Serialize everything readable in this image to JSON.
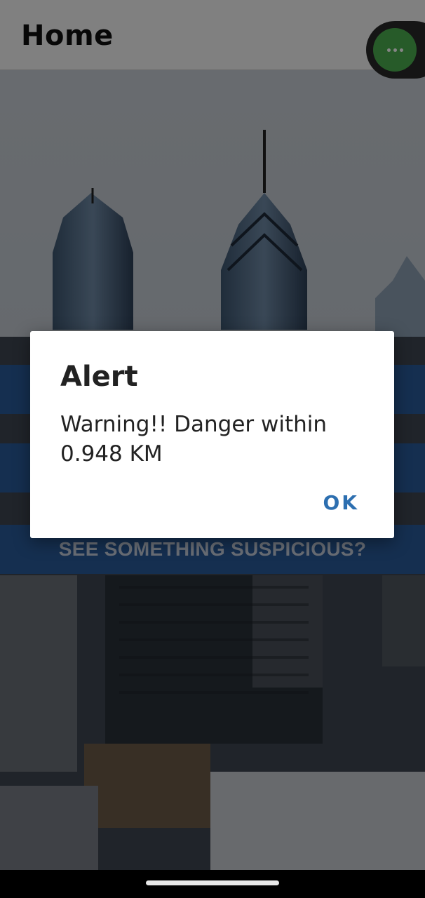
{
  "app_bar": {
    "title": "Home",
    "overflow_icon": "more-horiz-icon",
    "accent_color": "#4caf50"
  },
  "home": {
    "buttons": [
      {
        "label": ""
      },
      {
        "label": ""
      },
      {
        "label": "SEE SOMETHING SUSPICIOUS?"
      }
    ],
    "button_color": "#2a5a9a"
  },
  "dialog": {
    "title": "Alert",
    "message": "Warning!! Danger within\n 0.948 KM",
    "ok_label": "OK"
  }
}
